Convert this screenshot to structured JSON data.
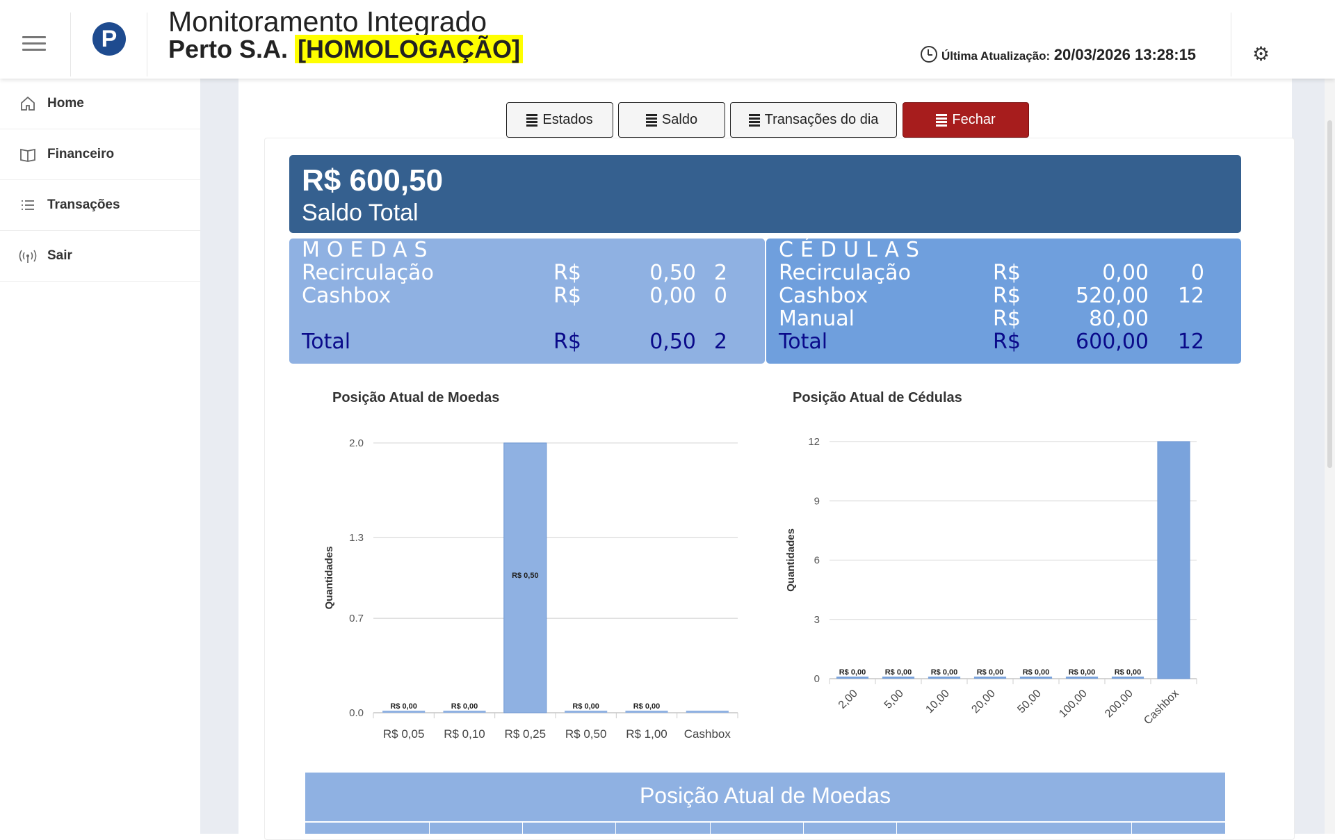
{
  "header": {
    "title_line1": "Monitoramento Integrado",
    "company": "Perto S.A.",
    "environment": "[HOMOLOGAÇÃO]",
    "logo_letter": "P",
    "update_label": "Última Atualização:",
    "update_value": "20/03/2026 13:28:15"
  },
  "sidebar": {
    "items": [
      {
        "label": "Home",
        "icon": "home-icon"
      },
      {
        "label": "Financeiro",
        "icon": "book-icon"
      },
      {
        "label": "Transações",
        "icon": "list-icon"
      },
      {
        "label": "Sair",
        "icon": "signal-icon"
      }
    ]
  },
  "toolbar": {
    "estados": "Estados",
    "saldo": "Saldo",
    "transacoes": "Transações do dia",
    "fechar": "Fechar",
    "fechar_color": "#a71d1d"
  },
  "saldo": {
    "amount": "R$ 600,50",
    "label": "Saldo Total",
    "color": "#35608f"
  },
  "moedas": {
    "header": "MOEDAS",
    "rows": [
      {
        "label": "Recirculação",
        "cur": "R$",
        "value": "0,50",
        "qty": "2"
      },
      {
        "label": "Cashbox",
        "cur": "R$",
        "value": "0,00",
        "qty": "0"
      }
    ],
    "total": {
      "label": "Total",
      "cur": "R$",
      "value": "0,50",
      "qty": "2"
    }
  },
  "cedulas": {
    "header": "CÉDULAS",
    "rows": [
      {
        "label": "Recirculação",
        "cur": "R$",
        "value": "0,00",
        "qty": "0"
      },
      {
        "label": "Cashbox",
        "cur": "R$",
        "value": "520,00",
        "qty": "12"
      },
      {
        "label": "Manual",
        "cur": "R$",
        "value": "80,00",
        "qty": ""
      }
    ],
    "total": {
      "label": "Total",
      "cur": "R$",
      "value": "600,00",
      "qty": "12"
    }
  },
  "chart_data": [
    {
      "type": "bar",
      "title": "Posição Atual de Moedas",
      "ylabel": "Quantidades",
      "xlabel": "",
      "categories": [
        "R$ 0,05",
        "R$ 0,10",
        "R$ 0,25",
        "R$ 0,50",
        "R$ 1,00",
        "Cashbox"
      ],
      "values": [
        0,
        0,
        2,
        0,
        0,
        0
      ],
      "data_labels": [
        "R$ 0,00",
        "R$ 0,00",
        "R$ 0,50",
        "R$ 0,00",
        "R$ 0,00",
        ""
      ],
      "yticks": [
        "0.0",
        "0.7",
        "1.3",
        "2.0"
      ],
      "ylim": [
        0,
        2
      ],
      "grid": true,
      "color": "#8fb1e2"
    },
    {
      "type": "bar",
      "title": "Posição Atual de Cédulas",
      "ylabel": "Quantidades",
      "xlabel": "",
      "categories": [
        "2,00",
        "5,00",
        "10,00",
        "20,00",
        "50,00",
        "100,00",
        "200,00",
        "Cashbox"
      ],
      "values": [
        0,
        0,
        0,
        0,
        0,
        0,
        0,
        12
      ],
      "data_labels": [
        "R$ 0,00",
        "R$ 0,00",
        "R$ 0,00",
        "R$ 0,00",
        "R$ 0,00",
        "R$ 0,00",
        "R$ 0,00",
        ""
      ],
      "yticks": [
        "0",
        "3",
        "6",
        "9",
        "12"
      ],
      "ylim": [
        0,
        12
      ],
      "grid": true,
      "color": "#7aa3dc"
    }
  ],
  "table": {
    "title": "Posição Atual de Moedas"
  }
}
